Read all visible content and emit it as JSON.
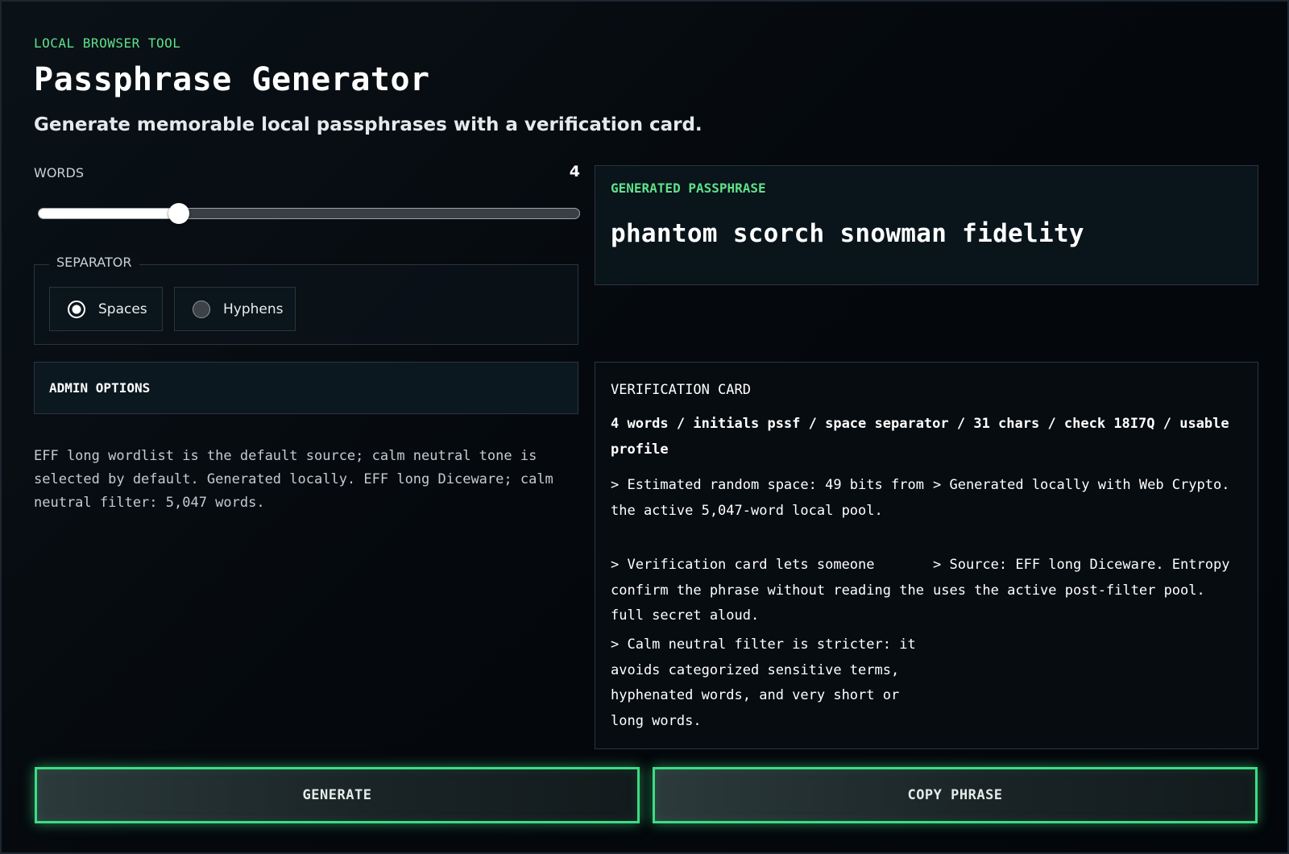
{
  "header": {
    "eyebrow": "LOCAL BROWSER TOOL",
    "title": "Passphrase Generator",
    "subtitle": "Generate memorable local passphrases with a verification card."
  },
  "words": {
    "label": "WORDS",
    "value": "4",
    "slider_fraction": 0.26
  },
  "separator": {
    "legend": "SEPARATOR",
    "options": [
      {
        "label": "Spaces",
        "selected": true
      },
      {
        "label": "Hyphens",
        "selected": false
      }
    ]
  },
  "admin": {
    "label": "ADMIN OPTIONS"
  },
  "note": "EFF long wordlist is the default source; calm neutral tone is selected by default. Generated locally. EFF long Diceware; calm neutral filter: 5,047 words.",
  "passphrase": {
    "label": "GENERATED PASSPHRASE",
    "value": "phantom scorch snowman fidelity"
  },
  "verification": {
    "title": "VERIFICATION CARD",
    "summary": "4 words / initials pssf / space separator / 31 chars / check 18I7Q / usable profile",
    "bullets": [
      "> Estimated random space: 49 bits from the active 5,047-word local pool.",
      "> Generated locally with Web Crypto.",
      "> Verification card lets someone confirm the phrase without reading the full secret aloud.",
      "> Source: EFF long Diceware. Entropy uses the active post-filter pool.",
      "> Calm neutral filter is stricter: it avoids categorized sensitive terms, hyphenated words, and very short or long words."
    ]
  },
  "actions": {
    "generate": "GENERATE",
    "copy": "COPY PHRASE"
  },
  "colors": {
    "accent": "#5fe08a",
    "button_glow": "#3ddc84",
    "background": "#05080b"
  }
}
